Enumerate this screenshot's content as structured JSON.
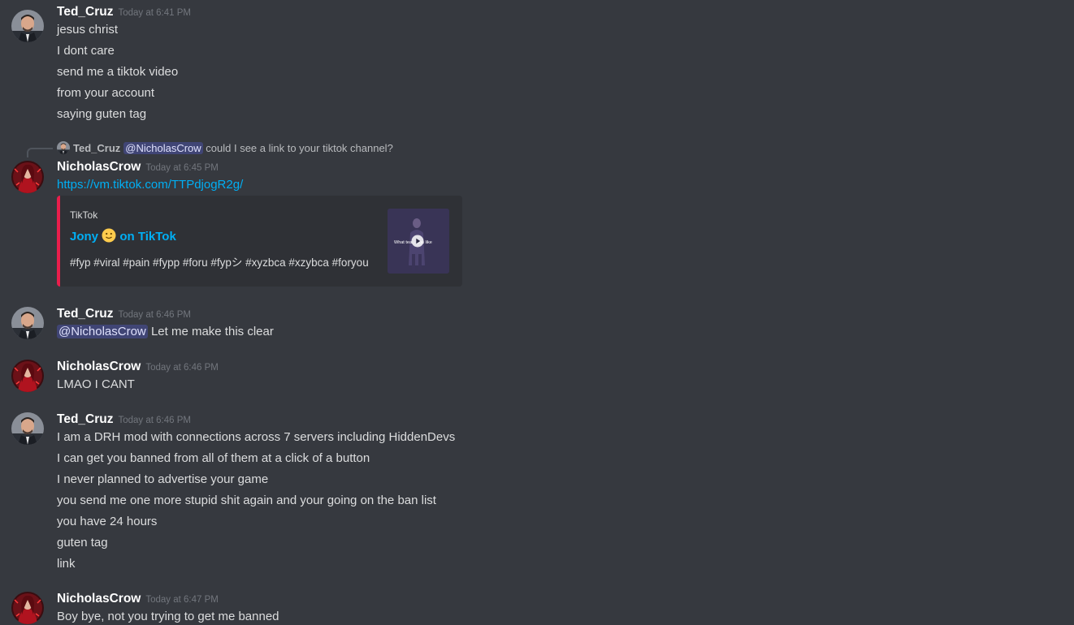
{
  "users": {
    "ted": {
      "name": "Ted_Cruz",
      "avatar_icon": "ted-cruz-avatar-icon"
    },
    "nicholas": {
      "name": "NicholasCrow",
      "avatar_icon": "nicholas-crow-avatar-icon"
    }
  },
  "messages": [
    {
      "user": "Ted_Cruz",
      "time": "Today at 6:41 PM",
      "lines": [
        "jesus christ",
        "I dont care",
        "send me a tiktok video",
        "from your account",
        "saying guten tag"
      ]
    },
    {
      "reply": {
        "user": "Ted_Cruz",
        "mention": "@NicholasCrow",
        "text": "could I see a link to your tiktok channel?"
      },
      "user": "NicholasCrow",
      "time": "Today at 6:45 PM",
      "link": "https://vm.tiktok.com/TTPdjogR2g/",
      "embed": {
        "provider": "TikTok",
        "title_prefix": "Jony",
        "title_suffix": "on TikTok",
        "description": "#fyp #viral #pain #fypp #foru #fypシ #xyzbca #xzybca #foryou",
        "thumb_text": "What tea... you like",
        "accent_color": "#e91e4c"
      }
    },
    {
      "user": "Ted_Cruz",
      "time": "Today at 6:46 PM",
      "mention": "@NicholasCrow",
      "text": "Let me make this clear"
    },
    {
      "user": "NicholasCrow",
      "time": "Today at 6:46 PM",
      "lines": [
        "LMAO I CANT"
      ]
    },
    {
      "user": "Ted_Cruz",
      "time": "Today at 6:46 PM",
      "lines": [
        "I am a DRH mod with connections across 7 servers including HiddenDevs",
        "I can get you banned from all of them at a click of a button",
        "I never planned to advertise your game",
        "you send me one more stupid shit again and your going on the ban list",
        "you have 24 hours",
        "guten tag",
        "link"
      ]
    },
    {
      "user": "NicholasCrow",
      "time": "Today at 6:47 PM",
      "lines": [
        "Boy bye, not you trying to get me banned"
      ]
    }
  ],
  "colors": {
    "background": "#36393f",
    "username": "#ffffff",
    "text": "#dcddde",
    "timestamp": "#72767d",
    "link": "#00aff4",
    "embed_bg": "#2f3136",
    "mention_text": "#dee0fc"
  }
}
